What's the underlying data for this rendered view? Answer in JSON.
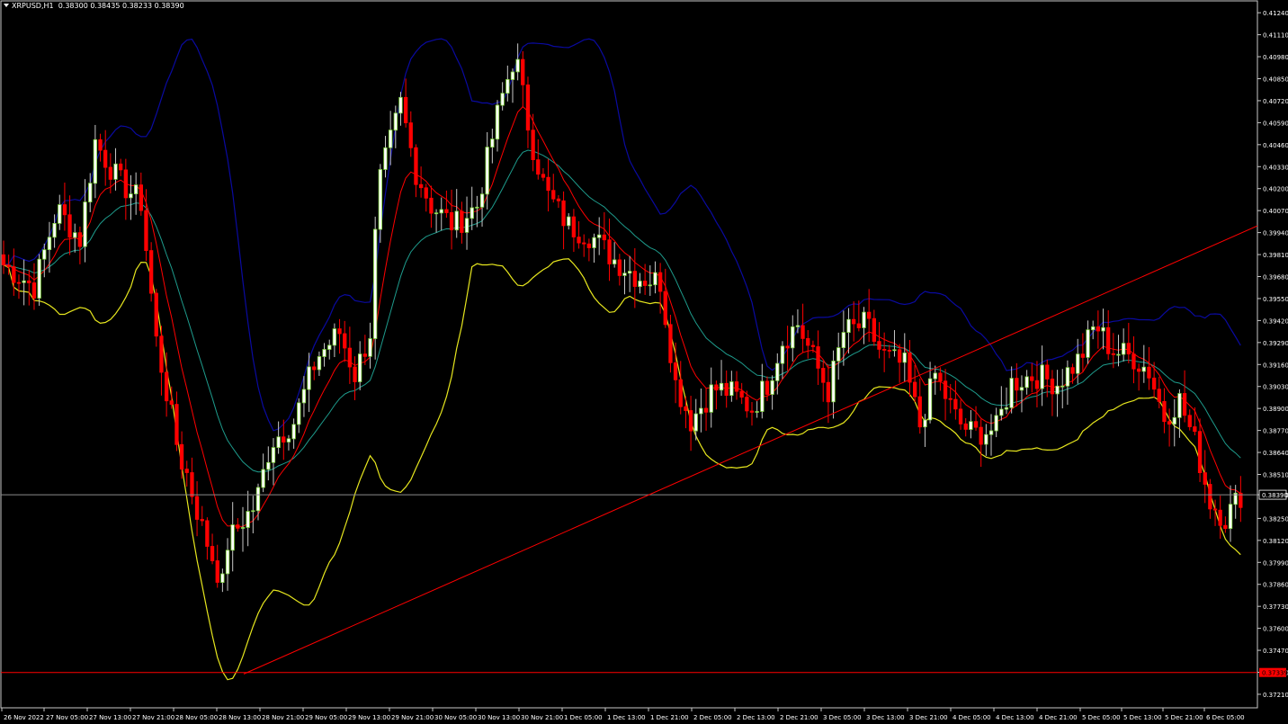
{
  "window": {
    "symbol": "XRPUSD,H1",
    "ohlc": "0.38300 0.38435 0.38233 0.38390"
  },
  "colors": {
    "background": "#000000",
    "frame": "#c8c8c8",
    "text": "#ffffff",
    "bull_candle": "#ffffff",
    "bull_outline": "#7fd23c",
    "bear_candle": "#ff0000",
    "bb_upper": "#0a0aa0",
    "bb_lower": "#e6e61e",
    "ema_fast": "#ff0000",
    "ema_slow": "#1e9b8c",
    "trendline": "#ff0000",
    "support_line": "#ff0000",
    "bid_line": "#8c8c8c",
    "price_tag_bg": "#ff0000"
  },
  "chart_data": {
    "type": "candlestick",
    "title": "XRPUSD,H1",
    "timeframe": "H1",
    "ylim": [
      0.3713,
      0.4131
    ],
    "y_ticks": [
      "0.41240",
      "0.41110",
      "0.40980",
      "0.40850",
      "0.40720",
      "0.40590",
      "0.40460",
      "0.40330",
      "0.40200",
      "0.40070",
      "0.39940",
      "0.39810",
      "0.39680",
      "0.39550",
      "0.39420",
      "0.39290",
      "0.39160",
      "0.39030",
      "0.38900",
      "0.38770",
      "0.38640",
      "0.38510",
      "0.38390",
      "0.38250",
      "0.38120",
      "0.37990",
      "0.37860",
      "0.37730",
      "0.37600",
      "0.37470",
      "0.37340",
      "0.37210"
    ],
    "x_ticks": [
      "26 Nov 2022",
      "27 Nov 05:00",
      "27 Nov 13:00",
      "27 Nov 21:00",
      "28 Nov 05:00",
      "28 Nov 13:00",
      "28 Nov 21:00",
      "29 Nov 05:00",
      "29 Nov 13:00",
      "29 Nov 21:00",
      "30 Nov 05:00",
      "30 Nov 13:00",
      "30 Nov 21:00",
      "1 Dec 05:00",
      "1 Dec 13:00",
      "1 Dec 21:00",
      "2 Dec 05:00",
      "2 Dec 13:00",
      "2 Dec 21:00",
      "3 Dec 05:00",
      "3 Dec 13:00",
      "3 Dec 21:00",
      "4 Dec 05:00",
      "4 Dec 13:00",
      "4 Dec 21:00",
      "5 Dec 05:00",
      "5 Dec 13:00",
      "5 Dec 21:00",
      "6 Dec 05:00"
    ],
    "bars": 244,
    "bid_price": "0.38390",
    "support_price": "0.37339",
    "trendline": {
      "from": [
        "28 Nov 13:00",
        0.3733
      ],
      "to": [
        "6 Dec 12:00",
        0.3998
      ]
    },
    "price_path": [
      [
        0,
        0.3975
      ],
      [
        8,
        0.3962
      ],
      [
        14,
        0.4008
      ],
      [
        20,
        0.399
      ],
      [
        24,
        0.4048
      ],
      [
        30,
        0.4025
      ],
      [
        36,
        0.4012
      ],
      [
        40,
        0.393
      ],
      [
        46,
        0.3862
      ],
      [
        52,
        0.383
      ],
      [
        58,
        0.3808
      ],
      [
        62,
        0.3822
      ],
      [
        66,
        0.3833
      ],
      [
        70,
        0.387
      ],
      [
        76,
        0.3882
      ],
      [
        82,
        0.392
      ],
      [
        88,
        0.3935
      ],
      [
        92,
        0.391
      ],
      [
        96,
        0.3935
      ],
      [
        98,
        0.402
      ],
      [
        104,
        0.407
      ],
      [
        108,
        0.403
      ],
      [
        112,
        0.401
      ],
      [
        118,
        0.3998
      ],
      [
        124,
        0.401
      ],
      [
        130,
        0.407
      ],
      [
        134,
        0.41
      ],
      [
        138,
        0.405
      ],
      [
        142,
        0.4018
      ],
      [
        148,
        0.3998
      ],
      [
        154,
        0.3992
      ],
      [
        160,
        0.3978
      ],
      [
        166,
        0.3968
      ],
      [
        172,
        0.3965
      ],
      [
        176,
        0.3905
      ],
      [
        180,
        0.3883
      ],
      [
        186,
        0.3902
      ],
      [
        190,
        0.39
      ],
      [
        196,
        0.389
      ],
      [
        200,
        0.3905
      ],
      [
        204,
        0.393
      ],
      [
        208,
        0.394
      ],
      [
        212,
        0.392
      ],
      [
        216,
        0.39
      ],
      [
        220,
        0.3935
      ],
      [
        226,
        0.394
      ],
      [
        230,
        0.3922
      ],
      [
        236,
        0.3915
      ],
      [
        240,
        0.388
      ],
      [
        244,
        0.391
      ],
      [
        250,
        0.3882
      ],
      [
        254,
        0.3875
      ],
      [
        260,
        0.3878
      ],
      [
        264,
        0.3905
      ],
      [
        270,
        0.391
      ],
      [
        276,
        0.3905
      ],
      [
        282,
        0.392
      ],
      [
        286,
        0.394
      ],
      [
        290,
        0.3925
      ],
      [
        296,
        0.392
      ],
      [
        300,
        0.3912
      ],
      [
        304,
        0.3885
      ],
      [
        308,
        0.3895
      ],
      [
        312,
        0.387
      ],
      [
        316,
        0.3835
      ],
      [
        320,
        0.3825
      ],
      [
        324,
        0.3839
      ]
    ]
  }
}
